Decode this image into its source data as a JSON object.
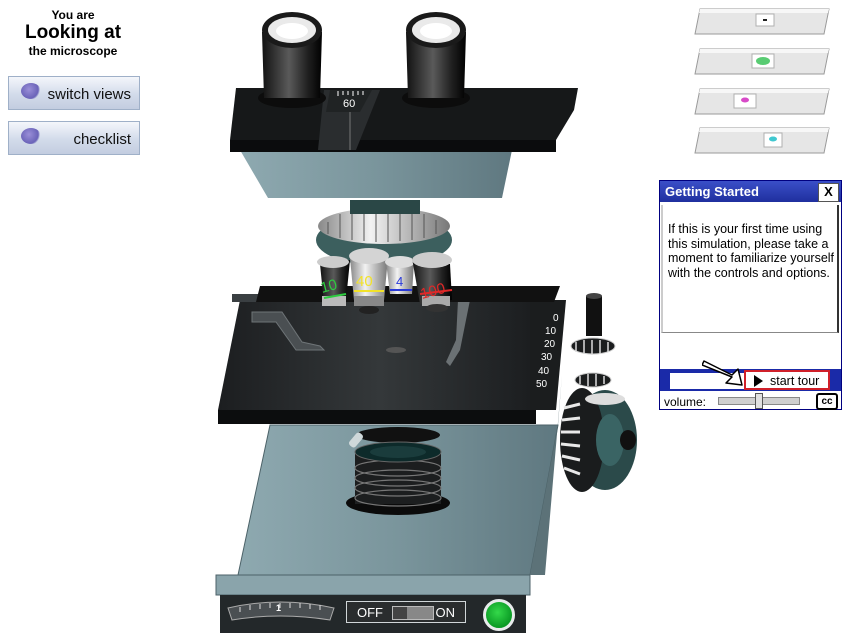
{
  "status": {
    "line1": "You are",
    "line2": "Looking at",
    "line3": "the microscope"
  },
  "left_buttons": {
    "switch_views": "switch views",
    "checklist": "checklist"
  },
  "slides": [
    {
      "name": "slide-1",
      "specimen_color": "#222222"
    },
    {
      "name": "slide-2",
      "specimen_color": "#3cc35a"
    },
    {
      "name": "slide-3",
      "specimen_color": "#d84ac8"
    },
    {
      "name": "slide-4",
      "specimen_color": "#40c8d0"
    }
  ],
  "dialog": {
    "title": "Getting Started",
    "close_label": "X",
    "body": "If this  is your first time using this simulation, please take a moment to familiarize yourself with the controls and options.",
    "start_tour": "start tour",
    "volume_label": "volume:",
    "volume_level": 0.5,
    "cc_label": "cc"
  },
  "microscope": {
    "eyepiece_scale": "60",
    "stage_scale": [
      "0",
      "10",
      "20",
      "30",
      "40",
      "50"
    ],
    "objectives": [
      {
        "label": "10",
        "color": "#2ecc40"
      },
      {
        "label": "40",
        "color": "#f2e22a"
      },
      {
        "label": "4",
        "color": "#2a3ad8"
      },
      {
        "label": "100",
        "color": "#e02828"
      }
    ],
    "light_dial": "1",
    "switch_off": "OFF",
    "switch_on": "ON"
  },
  "colors": {
    "body_slate": "#7e9aa1",
    "body_dark": "#2c2e30",
    "dialog_blue": "#1f2f9e"
  }
}
